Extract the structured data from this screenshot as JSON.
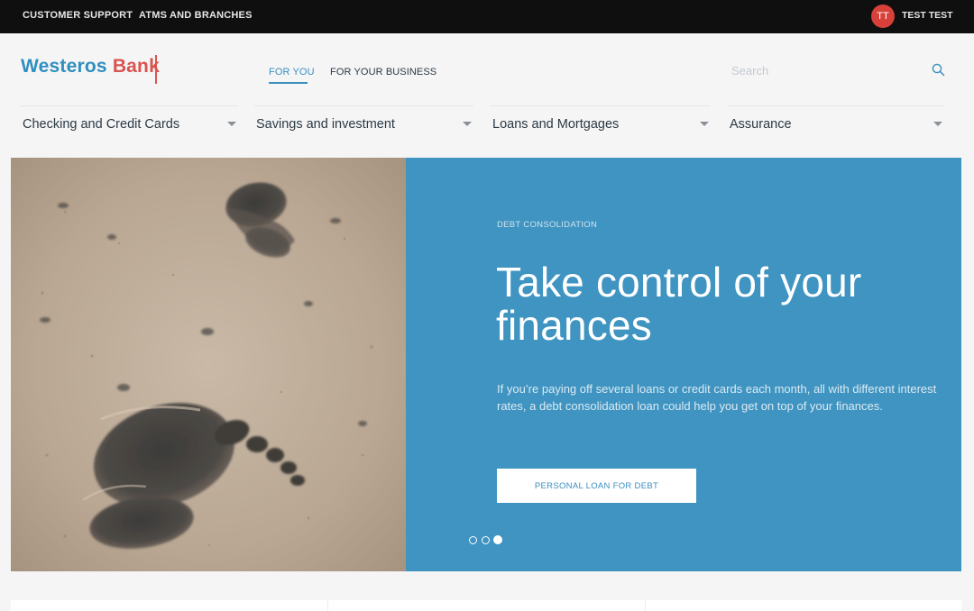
{
  "topbar": {
    "links": [
      "CUSTOMER SUPPORT",
      "ATMS AND BRANCHES"
    ],
    "user": {
      "initials": "TT",
      "name": "TEST TEST"
    }
  },
  "header": {
    "logo": {
      "part1": "Westeros",
      "part2": "Bank"
    },
    "tabs": [
      {
        "label": "FOR YOU",
        "active": true
      },
      {
        "label": "FOR YOUR BUSINESS",
        "active": false
      }
    ],
    "search": {
      "placeholder": "Search",
      "icon": "search-icon"
    }
  },
  "menu": {
    "items": [
      {
        "label": "Checking and Credit Cards"
      },
      {
        "label": "Savings and investment"
      },
      {
        "label": "Loans and Mortgages"
      },
      {
        "label": "Assurance"
      }
    ]
  },
  "hero": {
    "eyebrow": "DEBT CONSOLIDATION",
    "headline": "Take control of your finances",
    "body": "If you’re paying off several loans or credit cards each month, all with different interest rates, a debt consolidation loan could help you get on top of your finances.",
    "cta": "PERSONAL LOAN FOR DEBT",
    "slides_total": 3,
    "active_slide": 3
  },
  "colors": {
    "brand_blue": "#3f94c1",
    "brand_red": "#d9534f",
    "topbar": "#0f0f10"
  }
}
